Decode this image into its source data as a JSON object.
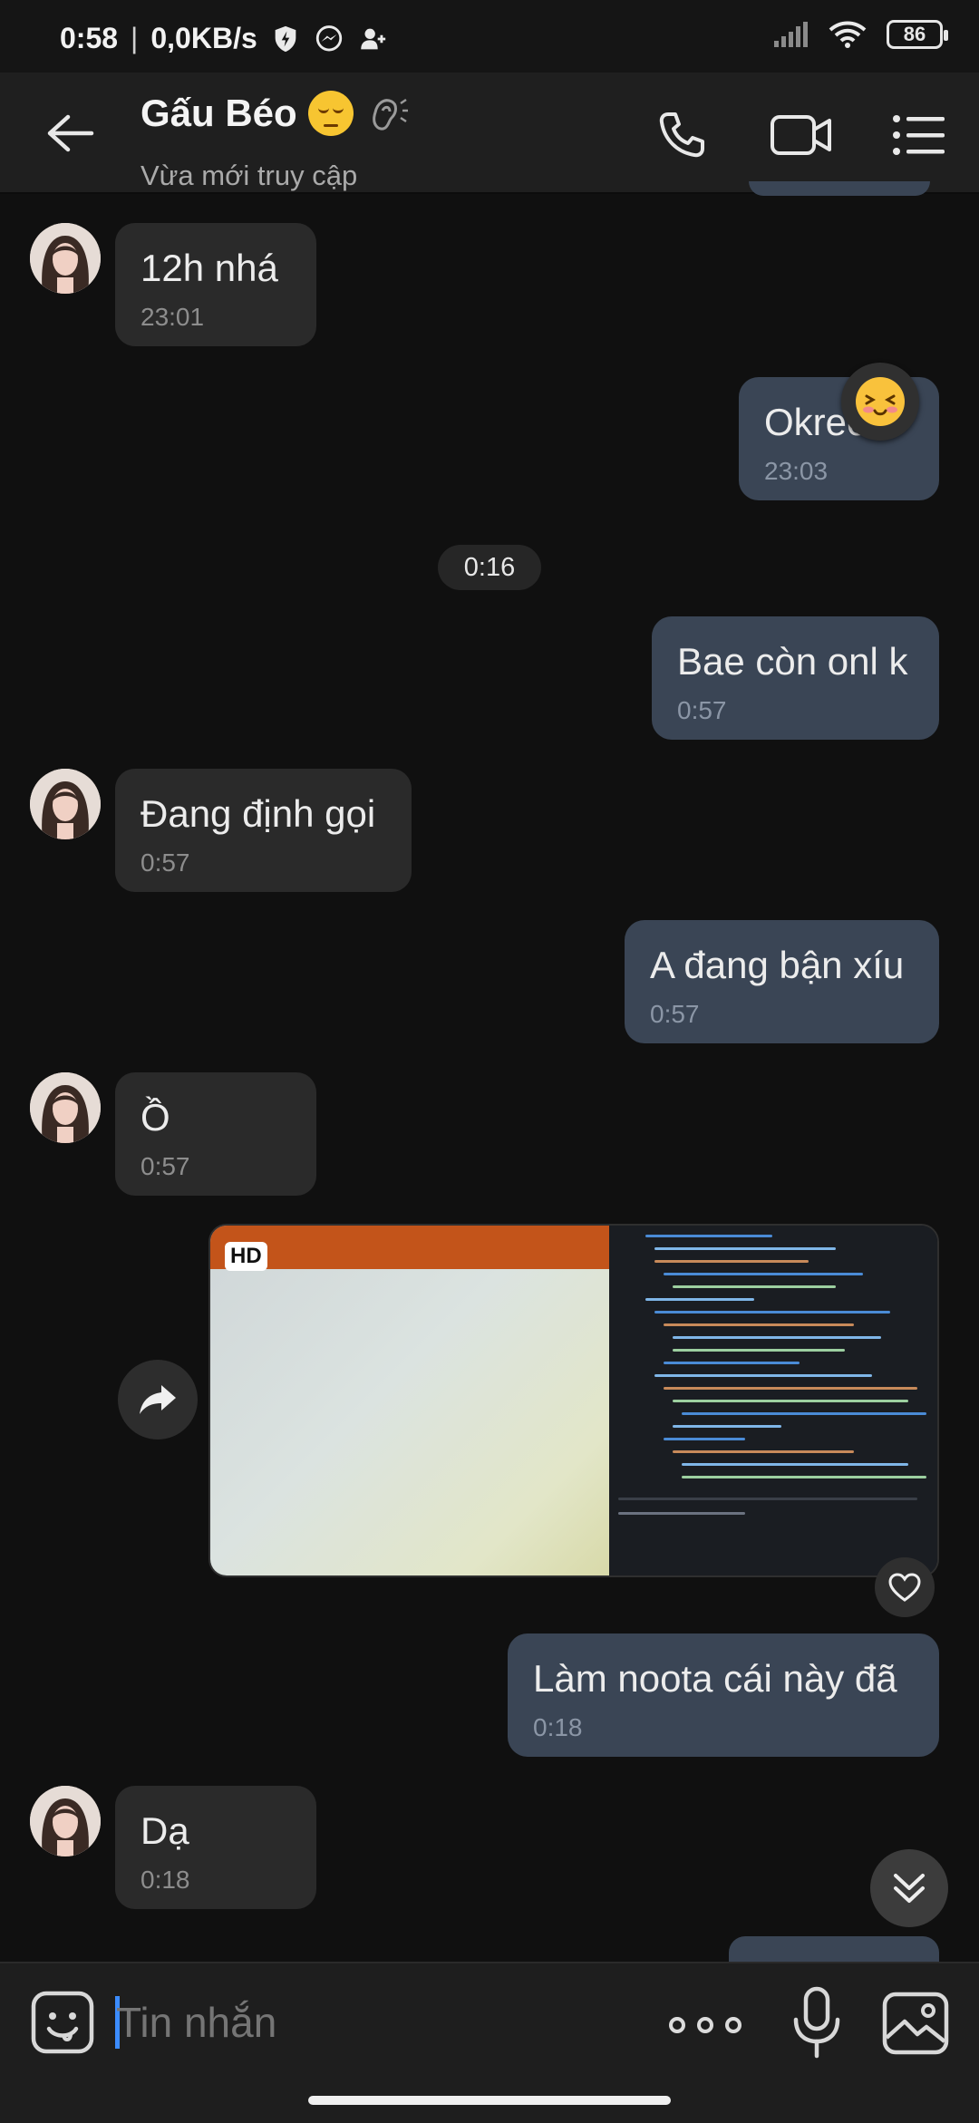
{
  "status_bar": {
    "time": "0:58",
    "network_speed": "0,0KB/s",
    "battery": "86",
    "icons": [
      "shield-icon",
      "messenger-icon",
      "user-add-icon",
      "signal-icon",
      "wifi-icon",
      "battery-icon"
    ]
  },
  "header": {
    "contact_name": "Gấu Béo",
    "status": "Vừa mới truy cập",
    "icons": [
      "back-arrow-icon",
      "phone-icon",
      "video-call-icon",
      "menu-icon"
    ]
  },
  "messages": [
    {
      "direction": "in",
      "text": "12h nhá",
      "time": "23:01"
    },
    {
      "direction": "out",
      "text": "Okreeu",
      "time": "23:03",
      "reaction": "blushing-emoji"
    },
    {
      "separator": "0:16"
    },
    {
      "direction": "out",
      "text": "Bae còn onl k",
      "time": "0:57"
    },
    {
      "direction": "in",
      "text": "Đang định gọi",
      "time": "0:57"
    },
    {
      "direction": "out",
      "text": "A đang bận xíu",
      "time": "0:57"
    },
    {
      "direction": "in",
      "text": "Ồ",
      "time": "0:57"
    },
    {
      "direction": "out",
      "type": "image",
      "badge": "HD"
    },
    {
      "direction": "out",
      "text": "Làm noota cái này đã",
      "time": "0:18"
    },
    {
      "direction": "in",
      "text": "Dạ",
      "time": "0:18"
    }
  ],
  "composer": {
    "placeholder": "Tin nhắn",
    "icons": [
      "sticker-icon",
      "more-icon",
      "microphone-icon",
      "gallery-icon"
    ]
  },
  "colors": {
    "background": "#101010",
    "incoming_bubble": "#2a2a2a",
    "outgoing_bubble": "#3a4555",
    "accent": "#3c8cff"
  }
}
